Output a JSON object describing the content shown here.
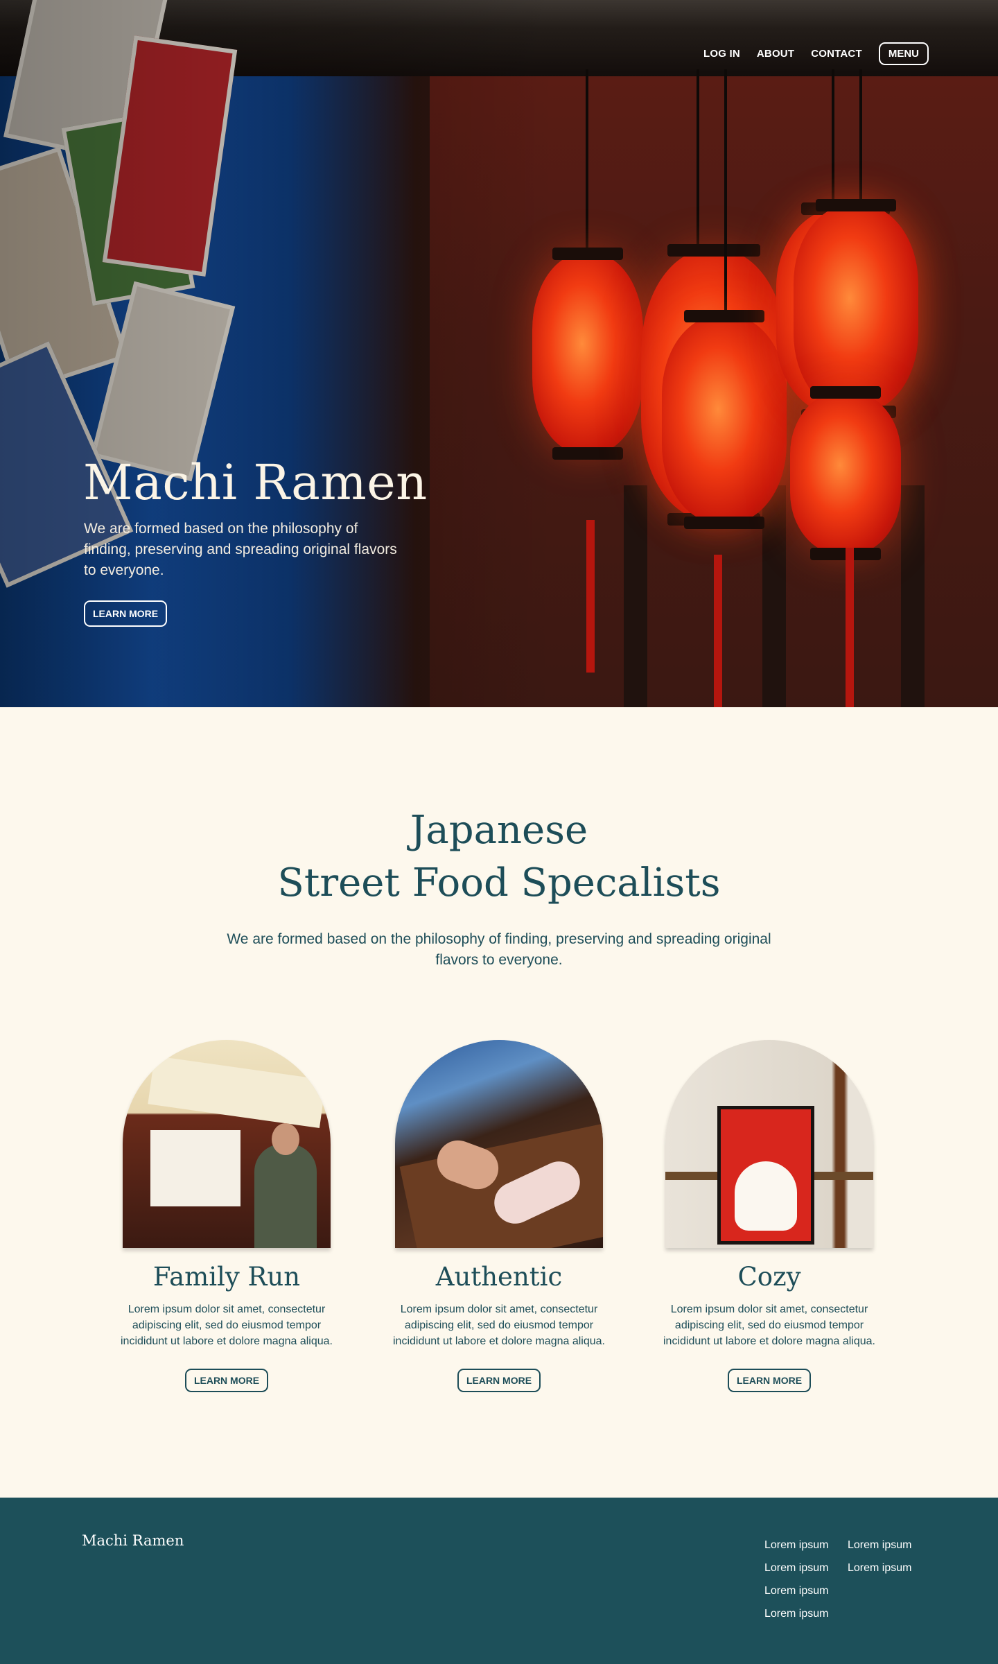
{
  "nav": {
    "login": "LOG IN",
    "about": "ABOUT",
    "contact": "CONTACT",
    "menu": "MENU"
  },
  "hero": {
    "title": "Machi Ramen",
    "subtitle": "We are formed based on the philosophy of finding, preserving and spreading original flavors to everyone.",
    "button": "LEARN MORE"
  },
  "intro": {
    "title_line1": "Japanese",
    "title_line2": "Street Food Specalists",
    "subtitle": "We are formed based on the philosophy of finding, preserving and spreading original flavors to everyone."
  },
  "features": [
    {
      "title": "Family Run",
      "text": "Lorem ipsum dolor sit amet, consectetur adipiscing elit, sed do eiusmod tempor incididunt ut labore et dolore magna aliqua.",
      "button": "LEARN MORE"
    },
    {
      "title": "Authentic",
      "text": "Lorem ipsum dolor sit amet, consectetur adipiscing elit, sed do eiusmod tempor incididunt ut labore et dolore magna aliqua.",
      "button": "LEARN MORE"
    },
    {
      "title": "Cozy",
      "text": "Lorem ipsum dolor sit amet, consectetur adipiscing elit, sed do eiusmod tempor incididunt ut labore et dolore magna aliqua.",
      "button": "LEARN MORE"
    }
  ],
  "footer": {
    "brand": "Machi Ramen",
    "links": [
      "Lorem ipsum",
      "Lorem ipsum",
      "Lorem ipsum",
      "Lorem ipsum",
      "Lorem ipsum",
      "Lorem ipsum"
    ]
  },
  "colors": {
    "brand_teal": "#1d4d58",
    "footer_bg": "#1d505a",
    "page_bg": "#fdf8ed",
    "lantern_red": "#f13b12"
  }
}
